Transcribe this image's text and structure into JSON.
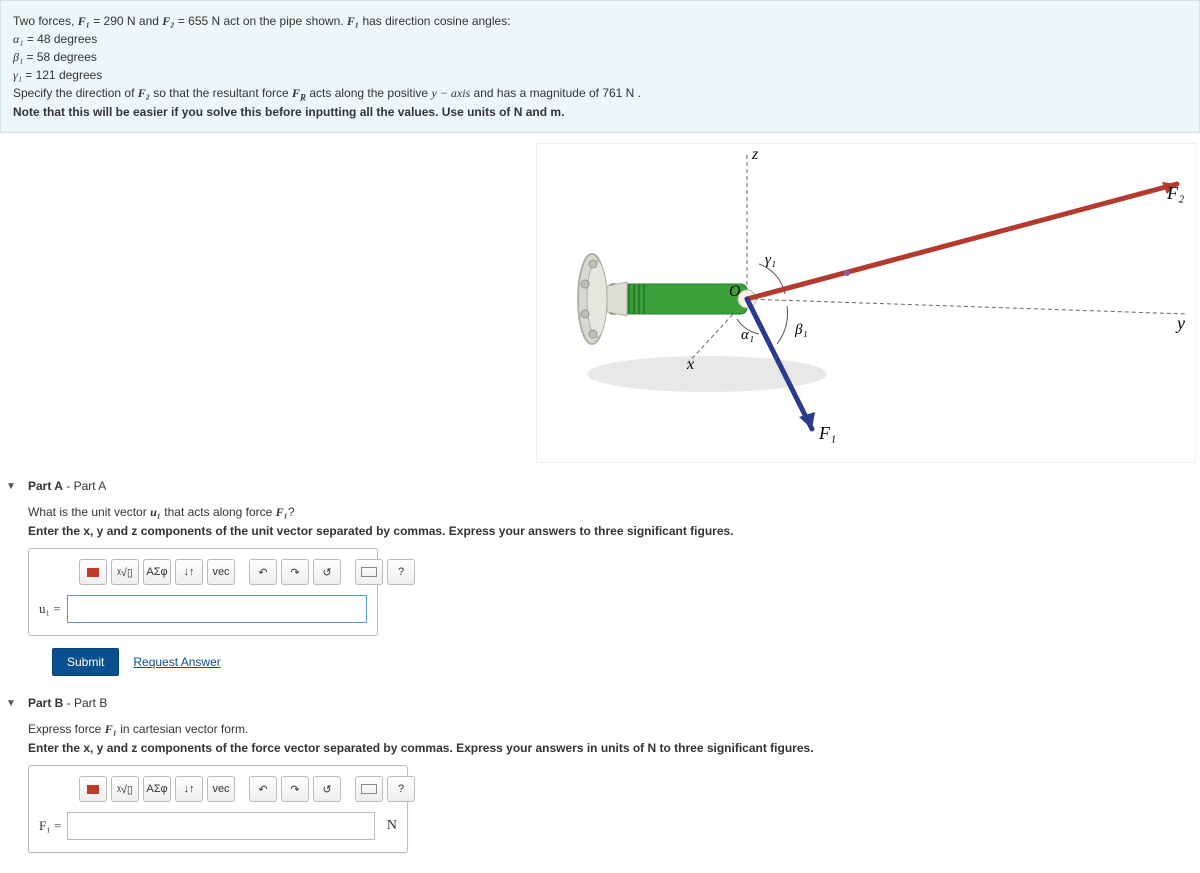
{
  "problem": {
    "intro_prefix": "Two forces, ",
    "F1_label": "F₁",
    "eq1": " = 290 N",
    "and": " and ",
    "F2_label": "F₂",
    "eq2": " = 655 N",
    "intro_suffix": " act on the pipe shown. ",
    "cosine_tail": " has direction cosine angles:",
    "alpha_line_lhs": "α₁",
    "alpha_line_rhs": " = 48 degrees",
    "beta_line_lhs": "β₁",
    "beta_line_rhs": " = 58 degrees",
    "gamma_line_lhs": "γ₁",
    "gamma_line_rhs": " = 121 degrees",
    "specify_prefix": "Specify the direction of ",
    "specify_mid1": " so that the resultant force ",
    "FR_label": "F_R",
    "specify_mid2": " acts along the positive ",
    "yaxis": "y − axis",
    "specify_suffix": " and has a magnitude of 761 N .",
    "note": "Note that this will be easier if you solve this before inputting all the values. Use units of N and m."
  },
  "figure": {
    "labels": {
      "z": "z",
      "y": "y",
      "x": "x",
      "O": "O",
      "gamma1": "γ₁",
      "alpha1": "α₁",
      "beta1": "β₁",
      "F1": "F₁",
      "F2": "F₂"
    }
  },
  "partA": {
    "header_bold": "Part A",
    "header_rest": " - Part A",
    "q_prefix": "What is the unit vector ",
    "u1": "u₁",
    "q_mid": " that acts along force ",
    "F1": "F₁",
    "q_suffix": "?",
    "instructions": "Enter the x, y and z components of the unit vector separated by commas. Express your answers to three significant figures.",
    "input_label": "u₁ =",
    "submit": "Submit",
    "request": "Request Answer"
  },
  "partB": {
    "header_bold": "Part B",
    "header_rest": " - Part B",
    "line1_prefix": "Express force ",
    "F1": "F₁",
    "line1_suffix": " in cartesian vector form.",
    "instructions": "Enter the x, y and z components of the force vector separated by commas. Express your answers in units of N to three significant figures.",
    "input_label": "F₁ =",
    "unit": "N"
  },
  "toolbar": {
    "template": "▭",
    "radical": "ᵡ√▯",
    "greek": "ΑΣφ",
    "arrows": "↓↑",
    "vec": "vec",
    "undo": "↶",
    "redo": "↷",
    "reset": "↺",
    "help": "?"
  }
}
